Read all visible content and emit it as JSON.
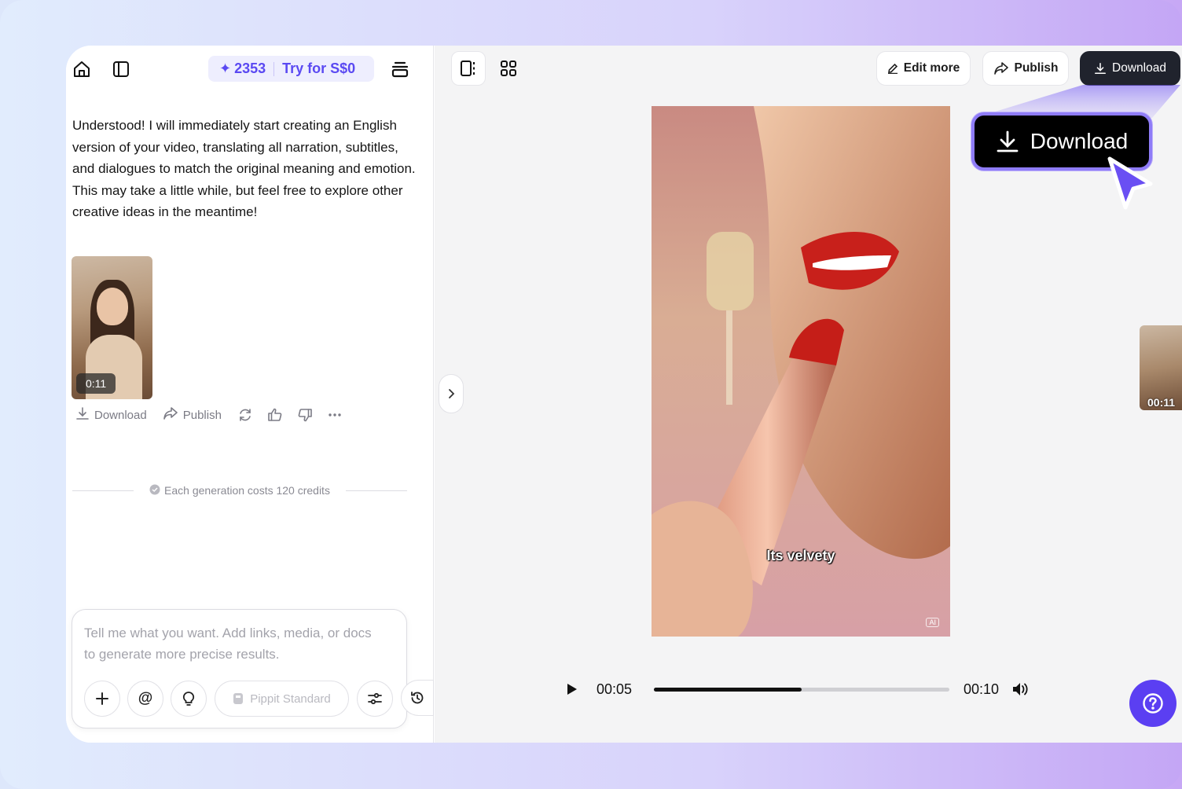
{
  "left_panel": {
    "credits": {
      "count": "2353",
      "try_label": "Try for S$0"
    },
    "message": "Understood! I will immediately start creating an English version of your video, translating all narration, subtitles, and dialogues to match the original meaning and emotion. This may take a little while, but feel free to explore other creative ideas in the meantime!",
    "thumbnail": {
      "duration": "0:11"
    },
    "actions": {
      "download": "Download",
      "publish": "Publish"
    },
    "cost_note": "Each generation costs 120 credits",
    "composer": {
      "placeholder": "Tell me what you want. Add links, media, or docs to generate more precise results.",
      "model": "Pippit Standard"
    }
  },
  "right_panel": {
    "toolbar": {
      "edit_more": "Edit more",
      "publish": "Publish",
      "download": "Download"
    },
    "video": {
      "subtitle": "Its velvety",
      "ai_badge": "AI"
    },
    "player": {
      "current_time": "00:05",
      "total_time": "00:10",
      "progress": 0.5
    },
    "side_thumbnail": {
      "duration": "00:11"
    }
  },
  "callout": {
    "label": "Download"
  },
  "colors": {
    "accent": "#5b3ff2",
    "dark_button": "#20232d",
    "credits_text": "#5a49f2"
  }
}
